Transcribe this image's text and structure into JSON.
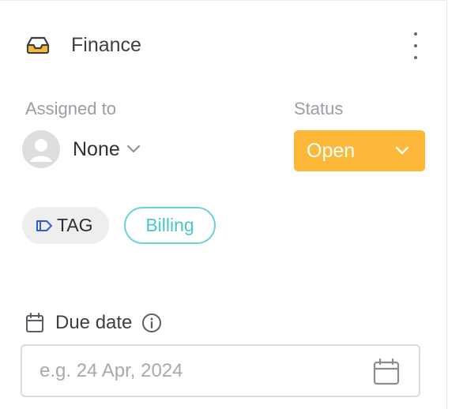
{
  "header": {
    "title": "Finance",
    "icon": "inbox-icon",
    "icon_color": "#f5b93a",
    "more_icon": "more-vertical-icon"
  },
  "assignee": {
    "label": "Assigned to",
    "value": "None",
    "avatar_icon": "user-avatar-icon",
    "chevron_icon": "chevron-down-icon"
  },
  "status": {
    "label": "Status",
    "value": "Open",
    "color": "#fdb83a",
    "chevron_icon": "chevron-down-icon"
  },
  "tags": {
    "tag_label": "TAG",
    "tag_icon": "tag-icon",
    "items": [
      "Billing"
    ],
    "billing_color": "#4cc4cc"
  },
  "due_date": {
    "label": "Due date",
    "calendar_icon": "calendar-icon",
    "info_icon": "info-icon",
    "placeholder": "e.g. 24 Apr, 2024",
    "value": "",
    "picker_icon": "calendar-icon"
  }
}
